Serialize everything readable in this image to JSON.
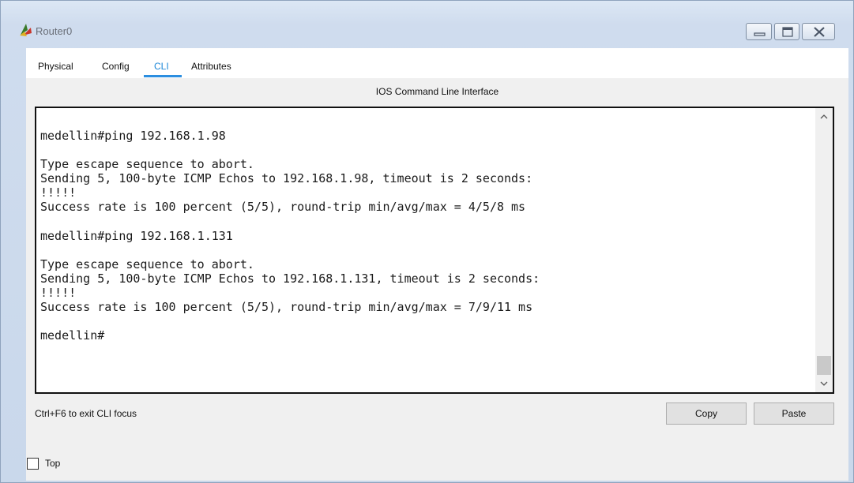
{
  "window": {
    "title": "Router0",
    "icon": "router-app-icon",
    "controls": {
      "minimize": "minimize-icon",
      "maximize": "maximize-icon",
      "close": "close-icon"
    }
  },
  "tabs": [
    {
      "label": "Physical",
      "active": false
    },
    {
      "label": "Config",
      "active": false
    },
    {
      "label": "CLI",
      "active": true
    },
    {
      "label": "Attributes",
      "active": false
    }
  ],
  "panel": {
    "header": "IOS Command Line Interface"
  },
  "terminal": {
    "output": "medellin#ping 192.168.1.98\n\nType escape sequence to abort.\nSending 5, 100-byte ICMP Echos to 192.168.1.98, timeout is 2 seconds:\n!!!!!\nSuccess rate is 100 percent (5/5), round-trip min/avg/max = 4/5/8 ms\n\nmedellin#ping 192.168.1.131\n\nType escape sequence to abort.\nSending 5, 100-byte ICMP Echos to 192.168.1.131, timeout is 2 seconds:\n!!!!!\nSuccess rate is 100 percent (5/5), round-trip min/avg/max = 7/9/11 ms\n\nmedellin#"
  },
  "footer": {
    "hint": "Ctrl+F6 to exit CLI focus",
    "copy_label": "Copy",
    "paste_label": "Paste",
    "top_label": "Top",
    "top_checked": false
  },
  "colors": {
    "active_tab": "#1e88d8",
    "titlebar": "#dce7f4"
  }
}
